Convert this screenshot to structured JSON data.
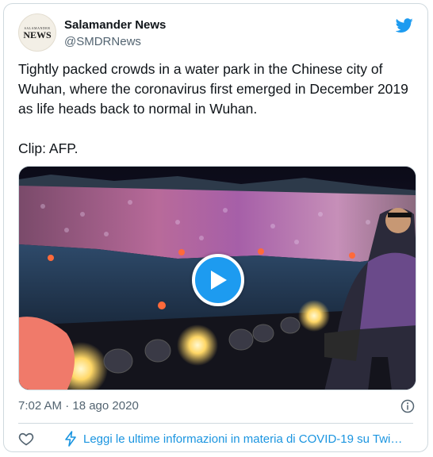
{
  "tweet": {
    "author_name": "Salamander News",
    "author_handle": "@SMDRNews",
    "avatar_logo_small": "SALAMANDER",
    "avatar_logo_big": "NEWS",
    "text_paragraph_1": "Tightly packed crowds in a water park in the Chinese city of Wuhan, where the coronavirus first emerged in December 2019 as life heads back to normal in Wuhan.",
    "text_paragraph_2": "Clip: AFP.",
    "timestamp": "7:02 AM · 18 ago 2020",
    "footer_link": "Leggi le ultime informazioni in materia di COVID-19 su Twi…"
  },
  "icons": {
    "brand": "twitter-bird-icon",
    "video": "play-icon",
    "info": "info-icon",
    "like": "heart-icon",
    "covid": "bolt-icon"
  },
  "colors": {
    "accent": "#1d9bf0",
    "link": "#1b95e0",
    "secondary_text": "#536471",
    "border": "#cfd9de"
  }
}
